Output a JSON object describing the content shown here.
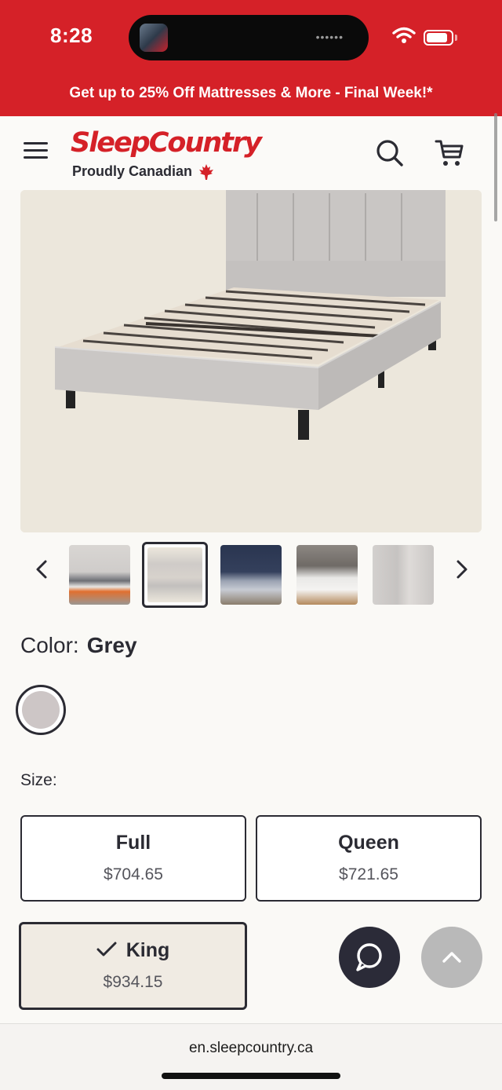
{
  "status_bar": {
    "time": "8:28",
    "island_dots": "••••••"
  },
  "promo": {
    "text": "Get up to 25% Off Mattresses & More - Final Week!*"
  },
  "header": {
    "logo_text": "SleepCountry",
    "tagline": "Proudly Canadian",
    "icons": [
      "menu-icon",
      "search-icon",
      "cart-icon",
      "maple-leaf-icon"
    ]
  },
  "product": {
    "color_label": "Color:",
    "color_value": "Grey",
    "swatch_color": "#cdc6c6",
    "size_label": "Size:",
    "sizes": [
      {
        "name": "Full",
        "price": "$704.65"
      },
      {
        "name": "Queen",
        "price": "$721.65"
      },
      {
        "name": "King",
        "price": "$934.15",
        "selected": true
      }
    ],
    "thumbnails": [
      {
        "name": "bedroom-grey-orange",
        "selected": false
      },
      {
        "name": "bed-frame-slats",
        "selected": true
      },
      {
        "name": "bedroom-navy-wall",
        "selected": false
      },
      {
        "name": "bedroom-white-bedding",
        "selected": false
      },
      {
        "name": "headboard-closeup",
        "selected": false
      }
    ]
  },
  "browser": {
    "url": "en.sleepcountry.ca"
  },
  "colors": {
    "brand_red": "#d52128",
    "dark": "#2b2b33",
    "chat_button": "#2b2b38",
    "scroll_top_button": "#b9b9b9"
  }
}
